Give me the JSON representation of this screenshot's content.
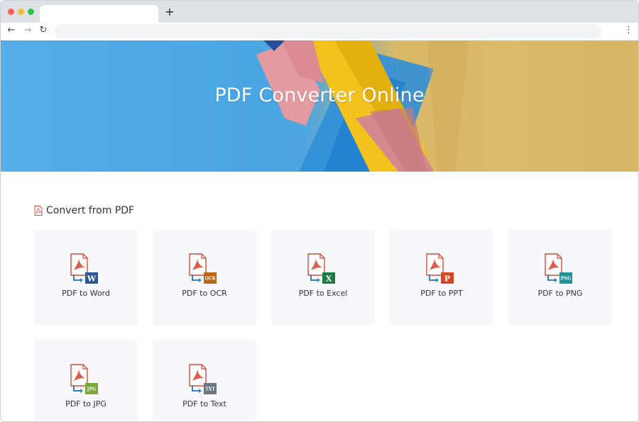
{
  "browser": {
    "new_tab_label": "+",
    "back_glyph": "←",
    "forward_glyph": "→",
    "reload_glyph": "↻",
    "menu_glyph": "⋮"
  },
  "hero": {
    "title": "PDF Converter Online"
  },
  "section": {
    "title": "Convert from PDF",
    "icon": "pdf-file-icon"
  },
  "tools": [
    {
      "label": "PDF to Word",
      "badge": "W",
      "badge_color": "#2b5797",
      "icon": "pdf-to-word-icon"
    },
    {
      "label": "PDF to OCR",
      "badge": "OCR",
      "badge_color": "#b8671a",
      "icon": "pdf-to-ocr-icon"
    },
    {
      "label": "PDF to Excel",
      "badge": "X",
      "badge_color": "#1f7a45",
      "icon": "pdf-to-excel-icon"
    },
    {
      "label": "PDF to PPT",
      "badge": "P",
      "badge_color": "#d24726",
      "icon": "pdf-to-ppt-icon"
    },
    {
      "label": "PDF to PNG",
      "badge": "PNG",
      "badge_color": "#23909a",
      "icon": "pdf-to-png-icon"
    },
    {
      "label": "PDF to JPG",
      "badge": "JPG",
      "badge_color": "#7aa83a",
      "icon": "pdf-to-jpg-icon"
    },
    {
      "label": "PDF to Text",
      "badge": "TXT",
      "badge_color": "#6b7880",
      "icon": "pdf-to-text-icon"
    }
  ],
  "colors": {
    "pdf_red": "#d64b3a",
    "arrow_blue": "#3a7fc0",
    "card_bg": "#f6f8fb"
  }
}
